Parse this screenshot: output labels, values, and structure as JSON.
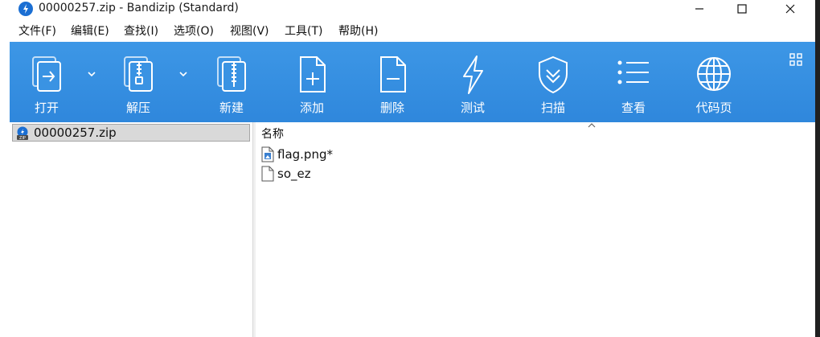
{
  "window": {
    "title": "00000257.zip - Bandizip (Standard)"
  },
  "menu": [
    {
      "id": "file",
      "label": "文件(F)"
    },
    {
      "id": "edit",
      "label": "编辑(E)"
    },
    {
      "id": "find",
      "label": "查找(I)"
    },
    {
      "id": "options",
      "label": "选项(O)"
    },
    {
      "id": "view",
      "label": "视图(V)"
    },
    {
      "id": "tools",
      "label": "工具(T)"
    },
    {
      "id": "help",
      "label": "帮助(H)"
    }
  ],
  "toolbar": {
    "open": "打开",
    "extract": "解压",
    "new": "新建",
    "add": "添加",
    "delete": "删除",
    "test": "测试",
    "scan": "扫描",
    "view": "查看",
    "codepage": "代码页"
  },
  "tree": {
    "archive": "00000257.zip"
  },
  "list": {
    "column_name": "名称",
    "files": [
      {
        "name": "flag.png*",
        "icon": "image-file-icon"
      },
      {
        "name": "so_ez",
        "icon": "file-icon"
      }
    ]
  },
  "colors": {
    "toolbar": "#3a93e3",
    "selection": "#d9d9d9",
    "accent": "#1b6fd3"
  }
}
